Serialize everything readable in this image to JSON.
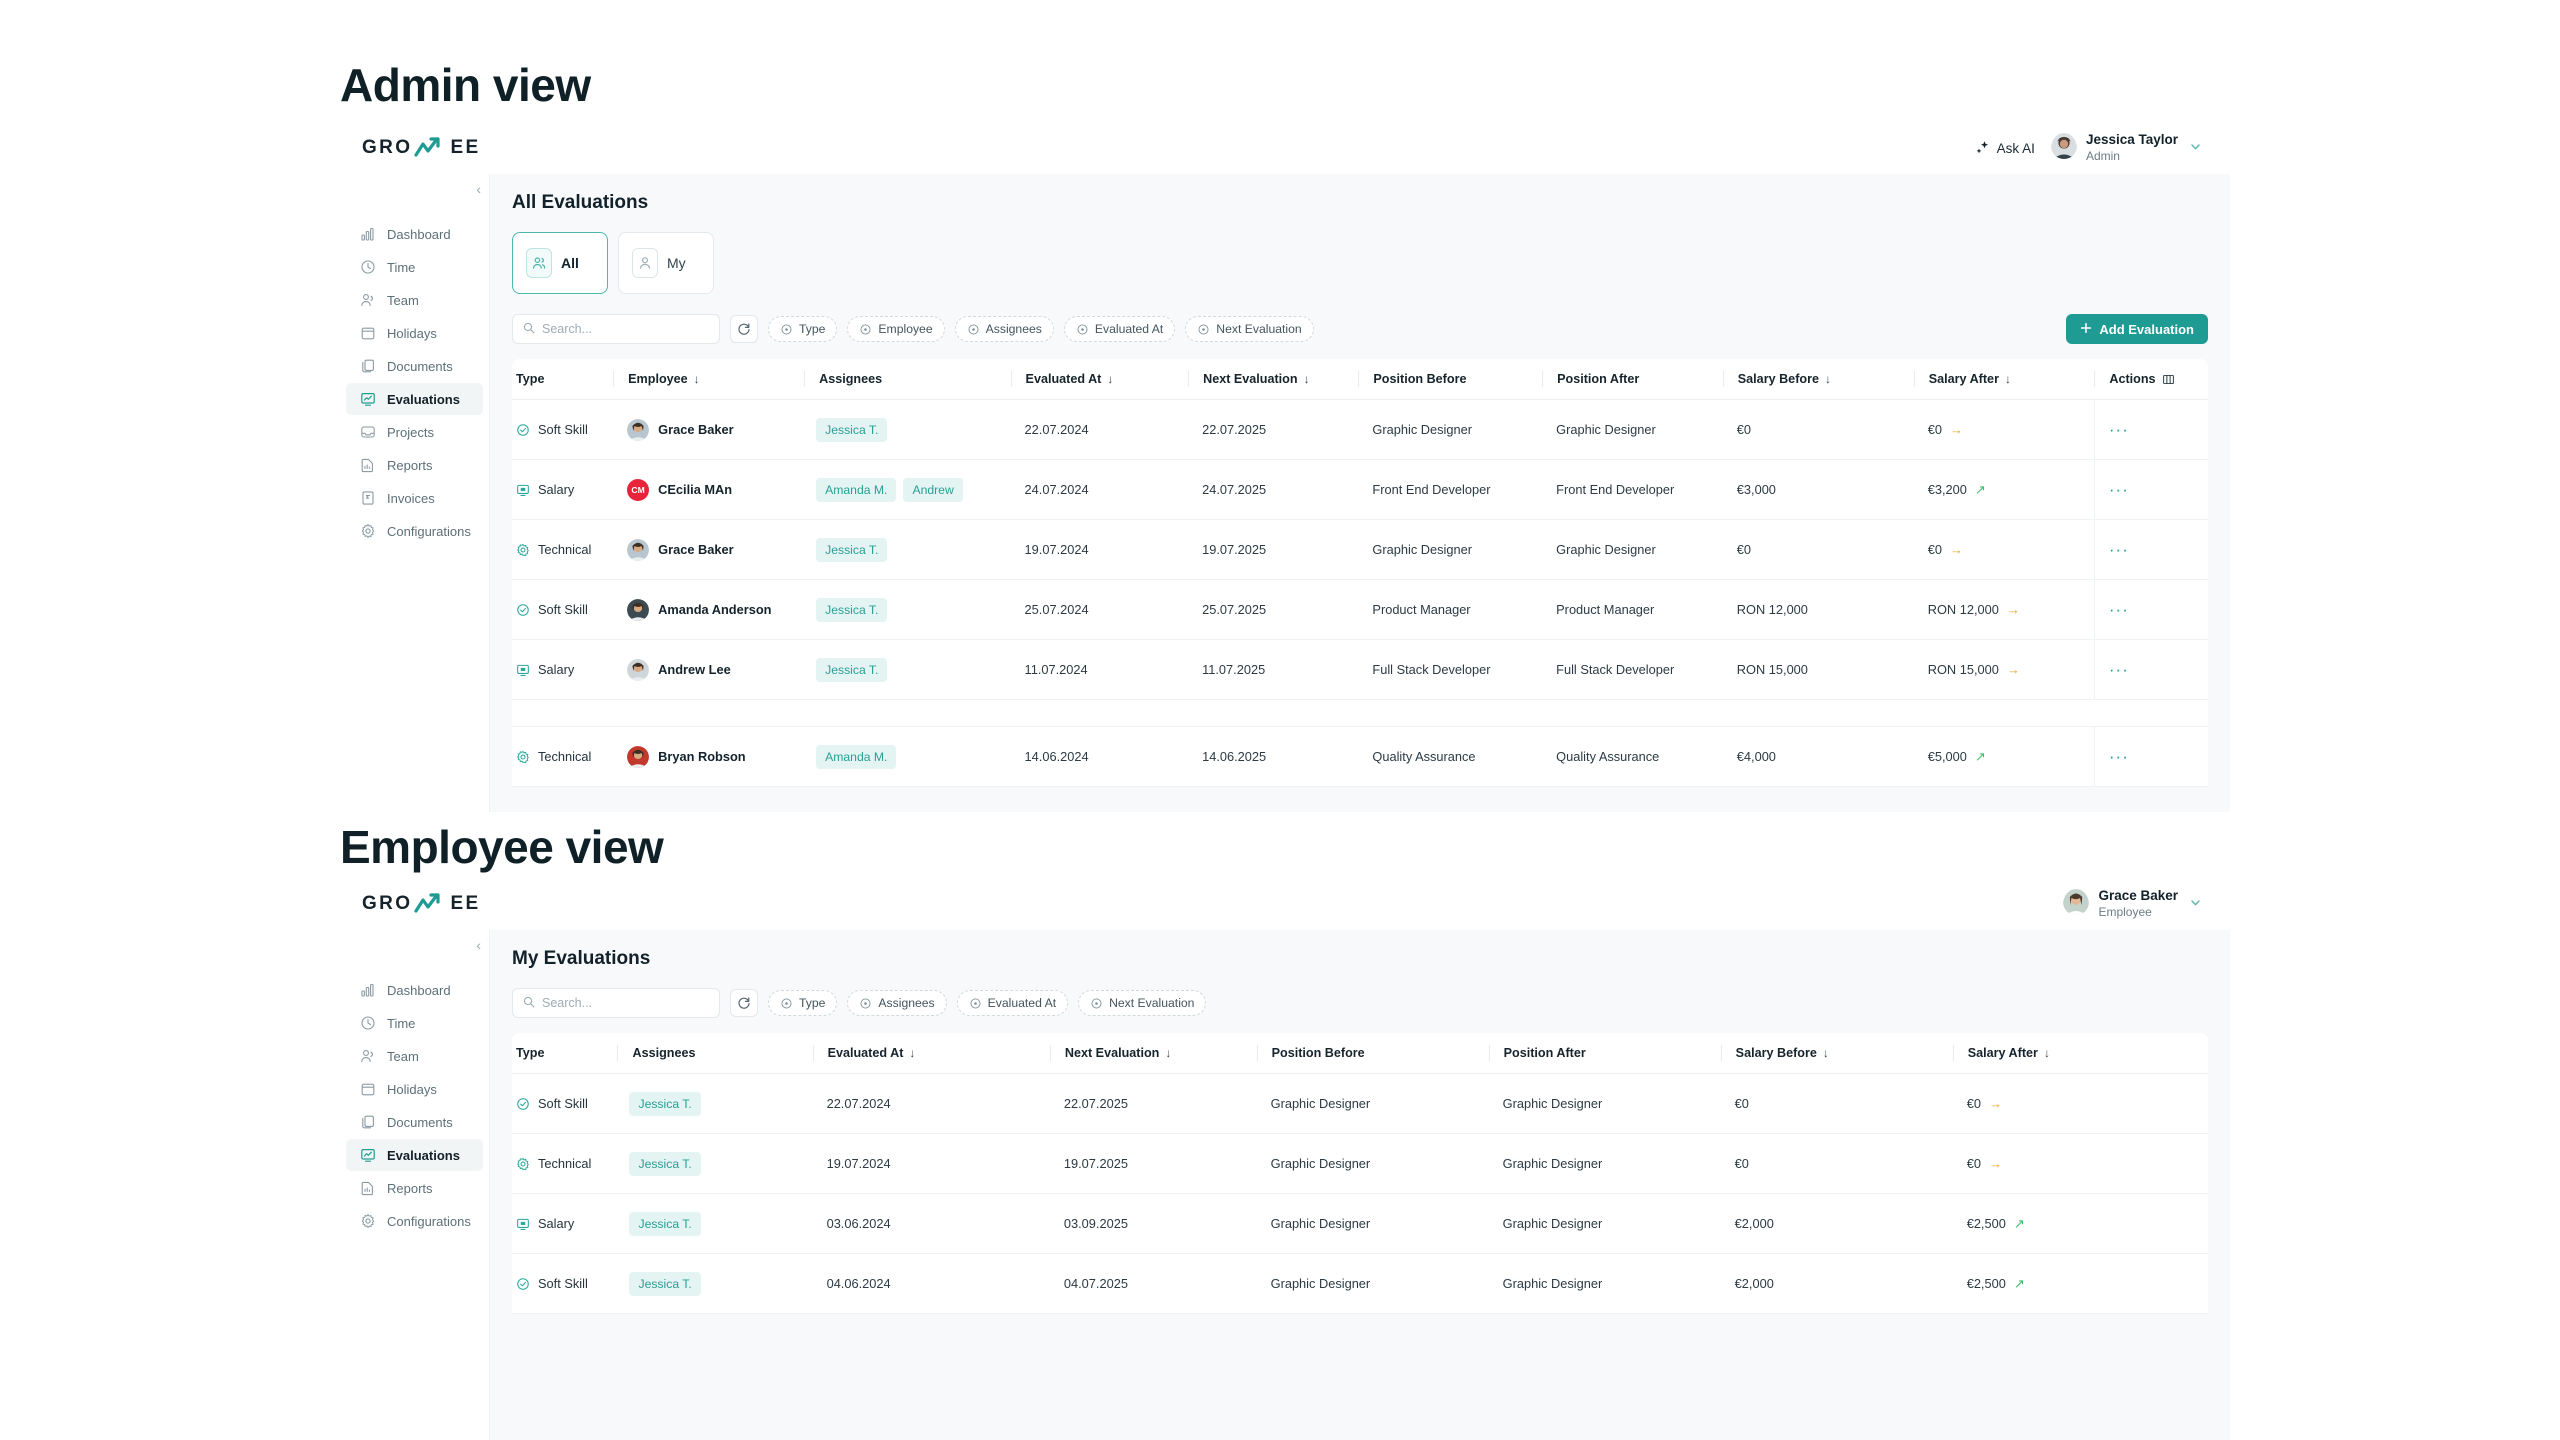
{
  "sections": [
    {
      "caption": "Admin view"
    },
    {
      "caption": "Employee view"
    }
  ],
  "brand": {
    "name_left": "GRO",
    "name_right": "EE",
    "accent": "#1e9b92"
  },
  "admin": {
    "header": {
      "ask_ai_label": "Ask AI",
      "user_name": "Jessica Taylor",
      "user_role": "Admin",
      "caret": "⌄"
    },
    "sidebar": {
      "items": [
        {
          "label": "Dashboard",
          "icon": "bar-chart-icon",
          "active": false
        },
        {
          "label": "Time",
          "icon": "clock-icon",
          "active": false
        },
        {
          "label": "Team",
          "icon": "users-icon",
          "active": false
        },
        {
          "label": "Holidays",
          "icon": "calendar-icon",
          "active": false
        },
        {
          "label": "Documents",
          "icon": "documents-icon",
          "active": false
        },
        {
          "label": "Evaluations",
          "icon": "evaluations-icon",
          "active": true
        },
        {
          "label": "Projects",
          "icon": "inbox-icon",
          "active": false
        },
        {
          "label": "Reports",
          "icon": "report-icon",
          "active": false
        },
        {
          "label": "Invoices",
          "icon": "invoice-icon",
          "active": false
        },
        {
          "label": "Configurations",
          "icon": "gear-icon",
          "active": false
        }
      ]
    },
    "title": "All Evaluations",
    "scope_tabs": [
      {
        "label": "All",
        "icon": "users-group-icon",
        "active": true
      },
      {
        "label": "My",
        "icon": "user-icon",
        "active": false
      }
    ],
    "toolbar": {
      "search_placeholder": "Search...",
      "refresh_icon": "refresh-icon",
      "filters": [
        "Type",
        "Employee",
        "Assignees",
        "Evaluated At",
        "Next Evaluation"
      ],
      "add_label": "Add Evaluation",
      "add_icon": "plus-icon"
    },
    "columns": [
      {
        "label": "Type",
        "sortable": false
      },
      {
        "label": "Employee",
        "sortable": true
      },
      {
        "label": "Assignees",
        "sortable": false
      },
      {
        "label": "Evaluated At",
        "sortable": true
      },
      {
        "label": "Next Evaluation",
        "sortable": true
      },
      {
        "label": "Position Before",
        "sortable": false
      },
      {
        "label": "Position After",
        "sortable": false
      },
      {
        "label": "Salary Before",
        "sortable": true
      },
      {
        "label": "Salary After",
        "sortable": true
      },
      {
        "label": "Actions",
        "sortable": false,
        "icon": "columns-icon"
      }
    ],
    "rows": [
      {
        "type": "Soft Skill",
        "type_icon": "check-circle-icon",
        "employee": "Grace Baker",
        "avatar_color": "#b9c6cf",
        "avatar_initials": "",
        "assignees": [
          "Jessica T."
        ],
        "evaluated_at": "22.07.2024",
        "next_evaluation": "22.07.2025",
        "position_before": "Graphic Designer",
        "position_after": "Graphic Designer",
        "salary_before": "€0",
        "salary_after": "€0",
        "trend": "flat",
        "actions": "···"
      },
      {
        "type": "Salary",
        "type_icon": "monitor-icon",
        "employee": "CEcilia MAn",
        "avatar_color": "#e8243b",
        "avatar_initials": "CM",
        "assignees": [
          "Amanda M.",
          "Andrew"
        ],
        "evaluated_at": "24.07.2024",
        "next_evaluation": "24.07.2025",
        "position_before": "Front End Developer",
        "position_after": "Front End Developer",
        "salary_before": "€3,000",
        "salary_after": "€3,200",
        "trend": "up",
        "actions": "···"
      },
      {
        "type": "Technical",
        "type_icon": "gear-circle-icon",
        "employee": "Grace Baker",
        "avatar_color": "#b9c6cf",
        "avatar_initials": "",
        "assignees": [
          "Jessica T."
        ],
        "evaluated_at": "19.07.2024",
        "next_evaluation": "19.07.2025",
        "position_before": "Graphic Designer",
        "position_after": "Graphic Designer",
        "salary_before": "€0",
        "salary_after": "€0",
        "trend": "flat",
        "actions": "···"
      },
      {
        "type": "Soft Skill",
        "type_icon": "check-circle-icon",
        "employee": "Amanda Anderson",
        "avatar_color": "#3c4a52",
        "avatar_initials": "",
        "assignees": [
          "Jessica T."
        ],
        "evaluated_at": "25.07.2024",
        "next_evaluation": "25.07.2025",
        "position_before": "Product Manager",
        "position_after": "Product Manager",
        "salary_before": "RON 12,000",
        "salary_after": "RON 12,000",
        "trend": "flat",
        "actions": "···"
      },
      {
        "type": "Salary",
        "type_icon": "monitor-icon",
        "employee": "Andrew Lee",
        "avatar_color": "#cfd6da",
        "avatar_initials": "",
        "assignees": [
          "Jessica T."
        ],
        "evaluated_at": "11.07.2024",
        "next_evaluation": "11.07.2025",
        "position_before": "Full Stack Developer",
        "position_after": "Full Stack Developer",
        "salary_before": "RON 15,000",
        "salary_after": "RON 15,000",
        "trend": "flat",
        "actions": "···"
      },
      {
        "type": "Technical",
        "type_icon": "gear-circle-icon",
        "employee": "Bryan Robson",
        "avatar_color": "#c0392b",
        "avatar_initials": "",
        "assignees": [
          "Amanda M."
        ],
        "evaluated_at": "14.06.2024",
        "next_evaluation": "14.06.2025",
        "position_before": "Quality Assurance",
        "position_after": "Quality Assurance",
        "salary_before": "€4,000",
        "salary_after": "€5,000",
        "trend": "up",
        "actions": "···"
      }
    ]
  },
  "employee": {
    "header": {
      "user_name": "Grace Baker",
      "user_role": "Employee",
      "caret": "⌄"
    },
    "sidebar": {
      "items": [
        {
          "label": "Dashboard",
          "icon": "bar-chart-icon",
          "active": false
        },
        {
          "label": "Time",
          "icon": "clock-icon",
          "active": false
        },
        {
          "label": "Team",
          "icon": "users-icon",
          "active": false
        },
        {
          "label": "Holidays",
          "icon": "calendar-icon",
          "active": false
        },
        {
          "label": "Documents",
          "icon": "documents-icon",
          "active": false
        },
        {
          "label": "Evaluations",
          "icon": "evaluations-icon",
          "active": true
        },
        {
          "label": "Reports",
          "icon": "report-icon",
          "active": false
        },
        {
          "label": "Configurations",
          "icon": "gear-icon",
          "active": false
        }
      ]
    },
    "title": "My Evaluations",
    "toolbar": {
      "search_placeholder": "Search...",
      "refresh_icon": "refresh-icon",
      "filters": [
        "Type",
        "Assignees",
        "Evaluated At",
        "Next Evaluation"
      ]
    },
    "columns": [
      {
        "label": "Type",
        "sortable": false
      },
      {
        "label": "Assignees",
        "sortable": false
      },
      {
        "label": "Evaluated At",
        "sortable": true
      },
      {
        "label": "Next Evaluation",
        "sortable": true
      },
      {
        "label": "Position Before",
        "sortable": false
      },
      {
        "label": "Position After",
        "sortable": false
      },
      {
        "label": "Salary Before",
        "sortable": true
      },
      {
        "label": "Salary After",
        "sortable": true
      }
    ],
    "rows": [
      {
        "type": "Soft Skill",
        "type_icon": "check-circle-icon",
        "assignees": [
          "Jessica T."
        ],
        "evaluated_at": "22.07.2024",
        "next_evaluation": "22.07.2025",
        "position_before": "Graphic Designer",
        "position_after": "Graphic Designer",
        "salary_before": "€0",
        "salary_after": "€0",
        "trend": "flat"
      },
      {
        "type": "Technical",
        "type_icon": "gear-circle-icon",
        "assignees": [
          "Jessica T."
        ],
        "evaluated_at": "19.07.2024",
        "next_evaluation": "19.07.2025",
        "position_before": "Graphic Designer",
        "position_after": "Graphic Designer",
        "salary_before": "€0",
        "salary_after": "€0",
        "trend": "flat"
      },
      {
        "type": "Salary",
        "type_icon": "monitor-icon",
        "assignees": [
          "Jessica T."
        ],
        "evaluated_at": "03.06.2024",
        "next_evaluation": "03.09.2025",
        "position_before": "Graphic Designer",
        "position_after": "Graphic Designer",
        "salary_before": "€2,000",
        "salary_after": "€2,500",
        "trend": "up"
      },
      {
        "type": "Soft Skill",
        "type_icon": "check-circle-icon",
        "assignees": [
          "Jessica T."
        ],
        "evaluated_at": "04.06.2024",
        "next_evaluation": "04.07.2025",
        "position_before": "Graphic Designer",
        "position_after": "Graphic Designer",
        "salary_before": "€2,000",
        "salary_after": "€2,500",
        "trend": "up"
      }
    ]
  }
}
